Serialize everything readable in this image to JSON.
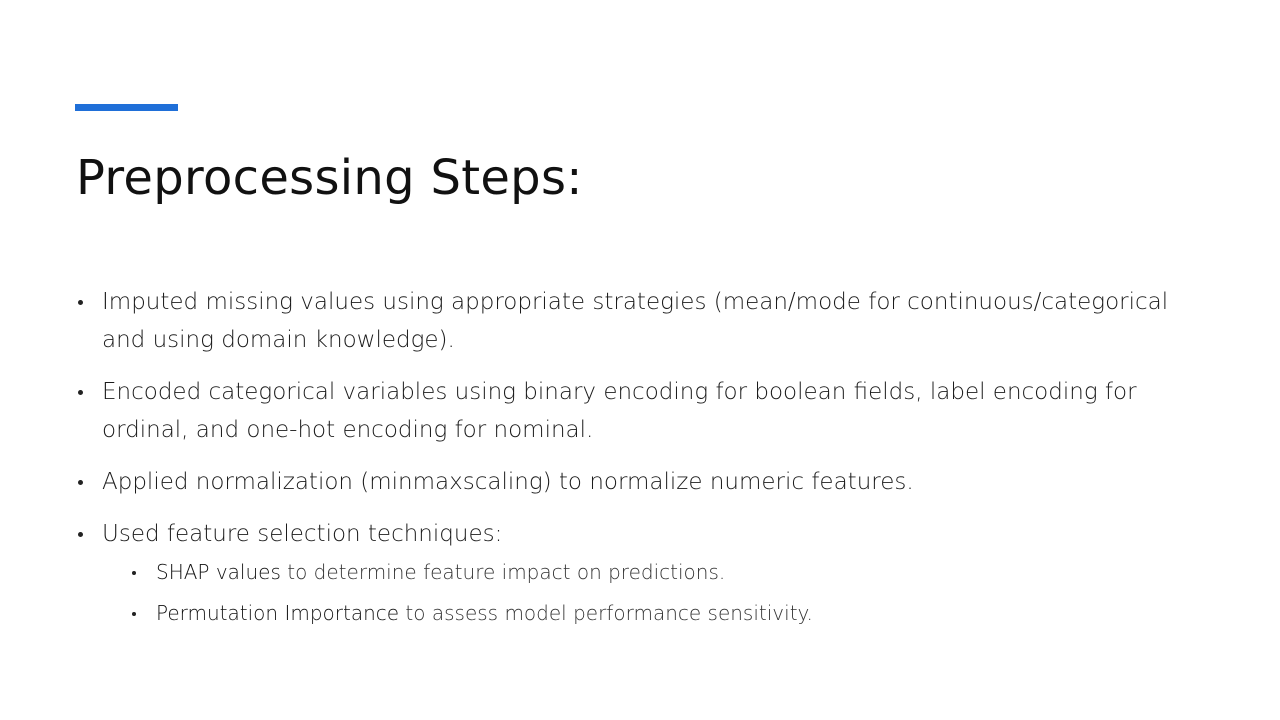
{
  "slide": {
    "title": "Preprocessing Steps:",
    "accent_color": "#1f6fd8",
    "bullets": [
      {
        "text": "Imputed missing values using appropriate strategies (mean/mode for continuous/categorical and using domain knowledge)."
      },
      {
        "text": "Encoded categorical variables using binary encoding for boolean fields, label encoding for ordinal, and one-hot encoding for nominal."
      },
      {
        "text": "Applied normalization (minmaxscaling) to normalize numeric features."
      },
      {
        "text": "Used feature selection techniques:",
        "sub_bullets": [
          {
            "term": "SHAP values",
            "desc": " to determine feature impact on predictions."
          },
          {
            "term": "Permutation Importance",
            "desc": " to assess model performance sensitivity."
          }
        ]
      }
    ]
  }
}
